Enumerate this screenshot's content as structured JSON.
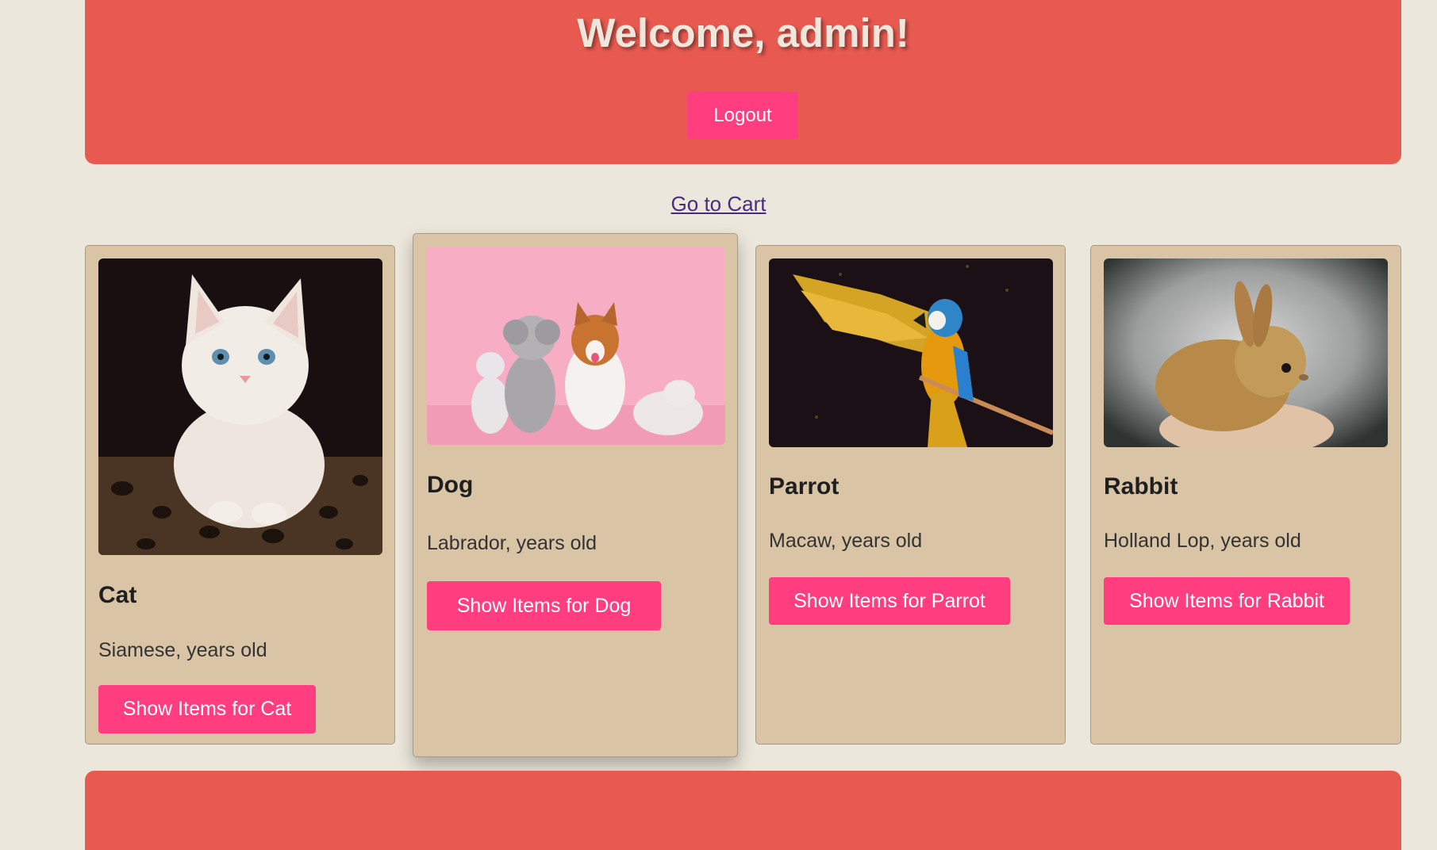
{
  "header": {
    "welcome": "Welcome, admin!",
    "logout_label": "Logout"
  },
  "nav": {
    "cart_link": "Go to Cart"
  },
  "pets": [
    {
      "name": "Cat",
      "desc": "Siamese, years old",
      "button": "Show Items for Cat",
      "icon": "cat-photo"
    },
    {
      "name": "Dog",
      "desc": "Labrador, years old",
      "button": "Show Items for Dog",
      "icon": "dogs-photo"
    },
    {
      "name": "Parrot",
      "desc": "Macaw, years old",
      "button": "Show Items for Parrot",
      "icon": "parrot-photo"
    },
    {
      "name": "Rabbit",
      "desc": "Holland Lop, years old",
      "button": "Show Items for Rabbit",
      "icon": "rabbit-photo"
    }
  ],
  "colors": {
    "background": "#ebe7dc",
    "header": "#e85a50",
    "card": "#d9c4a5",
    "button": "#ff3d7f",
    "link": "#4b2b7f"
  }
}
